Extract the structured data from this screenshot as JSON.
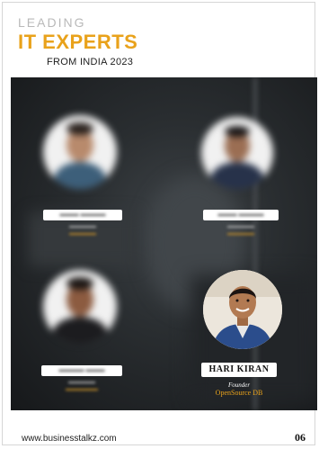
{
  "header": {
    "leading": "LEADING",
    "experts": "IT EXPERTS",
    "sub": "FROM INDIA 2023"
  },
  "featured": {
    "name": "HARI KIRAN",
    "role": "Founder",
    "company": "OpenSource DB"
  },
  "footer": {
    "url": "www.businesstalkz.com",
    "page": "06"
  },
  "colors": {
    "accent": "#e9a21b",
    "dark": "#1d1d1d"
  }
}
